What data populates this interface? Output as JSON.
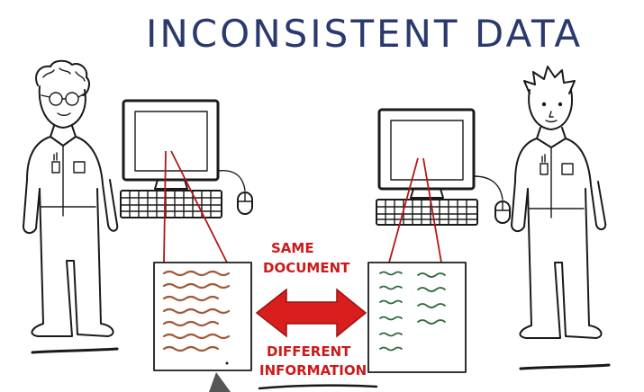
{
  "title": "INCONSISTENT DATA",
  "labels": {
    "same_line1": "SAME",
    "same_line2": "DOCUMENT",
    "different_line1": "DIFFERENT",
    "different_line2": "INFORMATION"
  },
  "colors": {
    "title": "#2a3a6e",
    "label_red": "#cc1a1a",
    "arrow_red": "#d91e1e",
    "doc_left_lines": "#a05a3a",
    "doc_right_lines": "#2e6b3e",
    "ink": "#1a1a1a"
  },
  "icons": [
    "person-left-illustration",
    "person-right-illustration",
    "computer-left-icon",
    "computer-right-icon",
    "mouse-left-icon",
    "mouse-right-icon",
    "double-arrow-icon"
  ]
}
